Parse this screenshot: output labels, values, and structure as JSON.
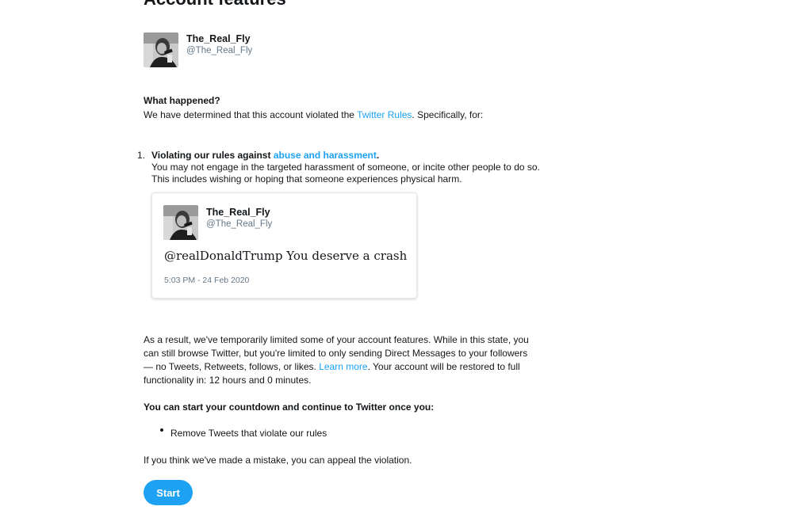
{
  "header": {
    "cut_title": "Account features"
  },
  "account": {
    "display_name": "The_Real_Fly",
    "handle": "@The_Real_Fly",
    "avatar_icon": "profile-photo"
  },
  "what_happened": {
    "heading": "What happened?",
    "line_prefix": "We have determined that this account violated the ",
    "rules_link": "Twitter Rules",
    "line_suffix": ". Specifically, for:"
  },
  "violation": {
    "number": "1.",
    "title_prefix": "Violating our rules against ",
    "title_link": "abuse and harassment",
    "title_suffix": ".",
    "desc_line1": "You may not engage in the targeted harassment of someone, or incite other people to do so.",
    "desc_line2": "This includes wishing or hoping that someone experiences physical harm."
  },
  "tweet": {
    "display_name": "The_Real_Fly",
    "handle": "@The_Real_Fly",
    "text": "@realDonaldTrump You deserve a crash",
    "timestamp": "5:03 PM - 24 Feb 2020"
  },
  "result": {
    "line1": "As a result, we've temporarily limited some of your account features. While in this state, you",
    "line2": "can still browse Twitter, but you're limited to only sending Direct Messages to your followers",
    "line3_prefix": "— no Tweets, Retweets, follows, or likes. ",
    "learn_more": "Learn more",
    "line3_suffix": ". Your account will be restored to full",
    "line4": "functionality in: 12 hours and 0 minutes."
  },
  "countdown": {
    "heading": "You can start your countdown and continue to Twitter once you:",
    "items": [
      "Remove Tweets that violate our rules"
    ]
  },
  "appeal": {
    "text": "If you think we've made a mistake, you can appeal the violation."
  },
  "actions": {
    "start_label": "Start"
  },
  "colors": {
    "link": "#1da1f2",
    "button_bg": "#1da1f2",
    "secondary_text": "#657786",
    "card_border": "#e1e8ed"
  }
}
